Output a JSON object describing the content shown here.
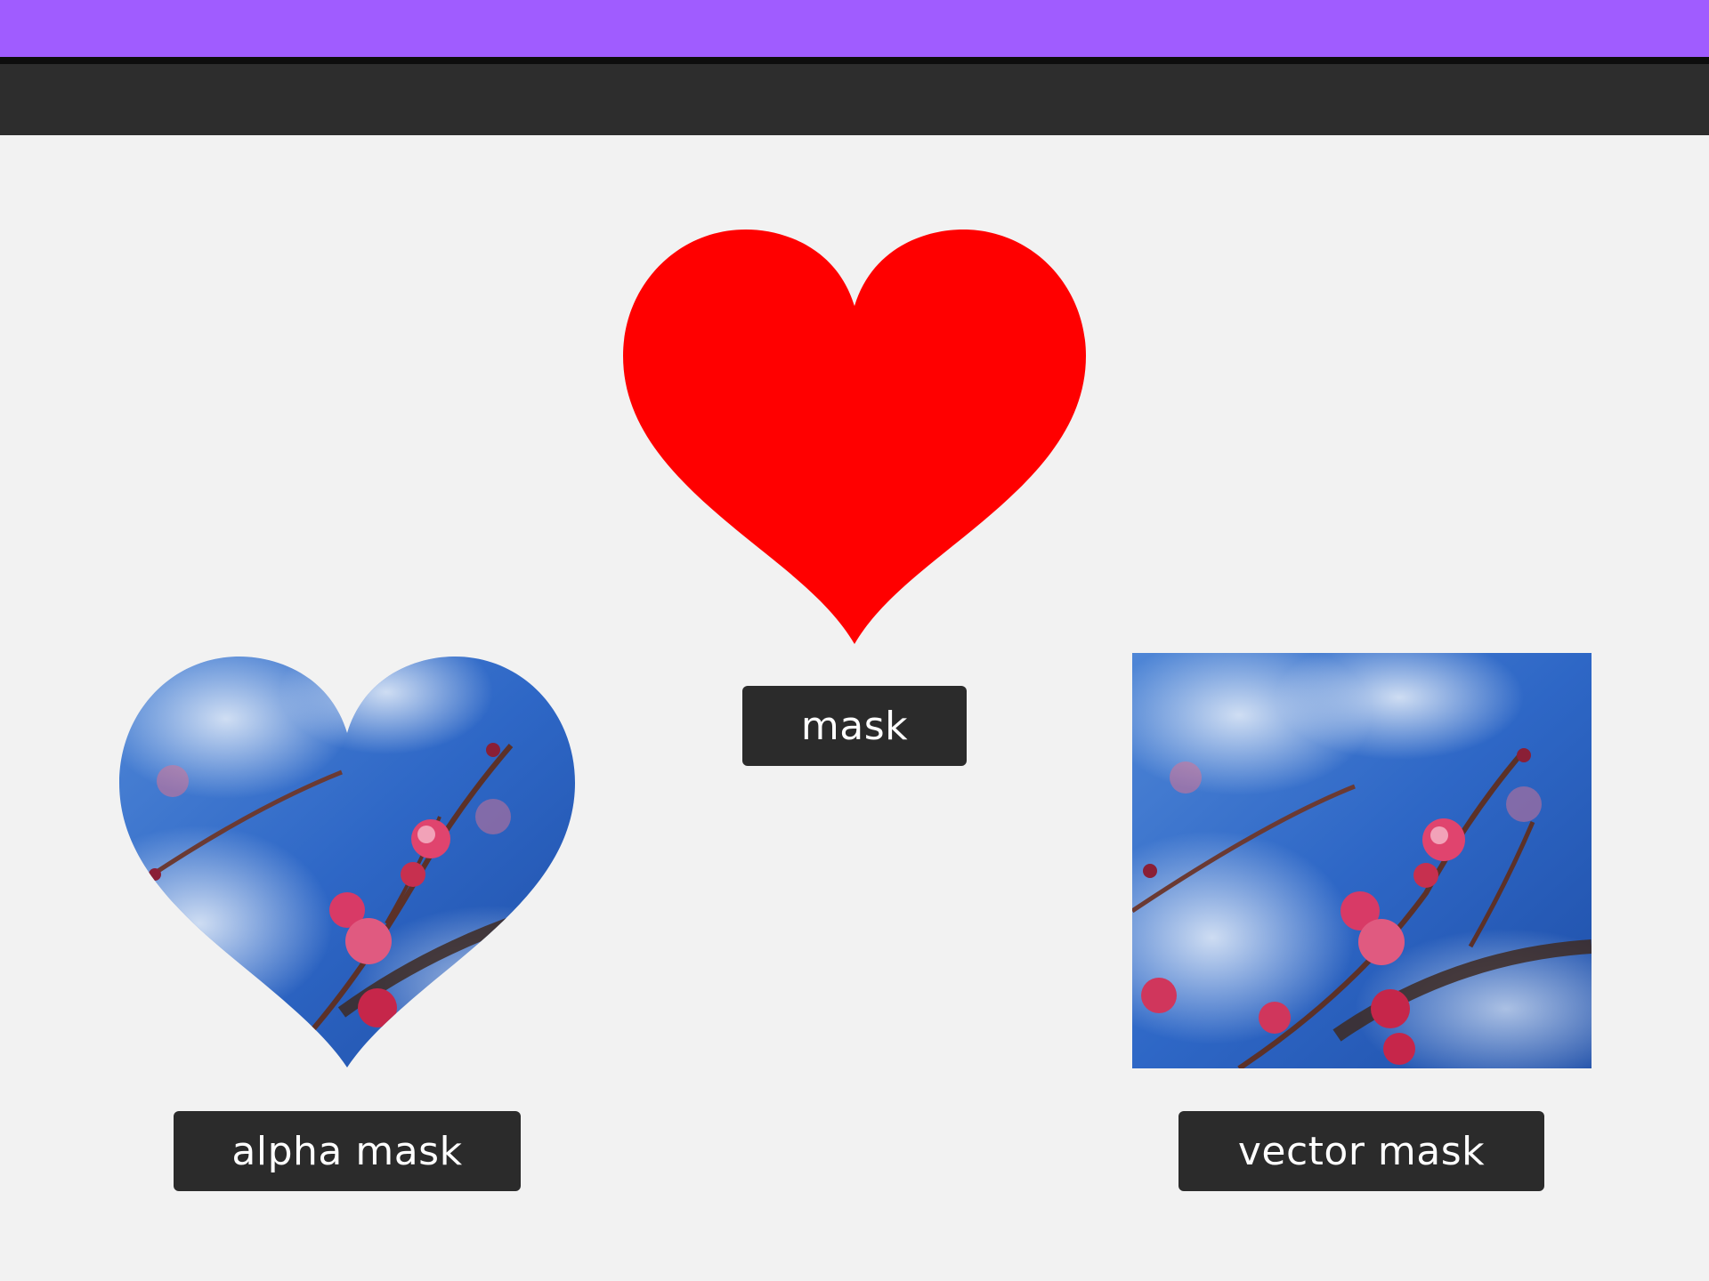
{
  "colors": {
    "title_bar": "#a05cff",
    "toolbar": "#2d2d2d",
    "canvas": "#f2f2f2",
    "heart": "#ff0000",
    "label_bg": "#2b2b2b",
    "label_text": "#ffffff",
    "sky": "#2f67c5",
    "blossom": "#e0446e"
  },
  "canvas": {
    "mask_label": "mask",
    "alpha_mask_label": "alpha mask",
    "vector_mask_label": "vector mask"
  },
  "items": {
    "mask_shape_icon": "heart-icon",
    "alpha_image": "plum-blossom-photo",
    "vector_image": "plum-blossom-photo"
  }
}
